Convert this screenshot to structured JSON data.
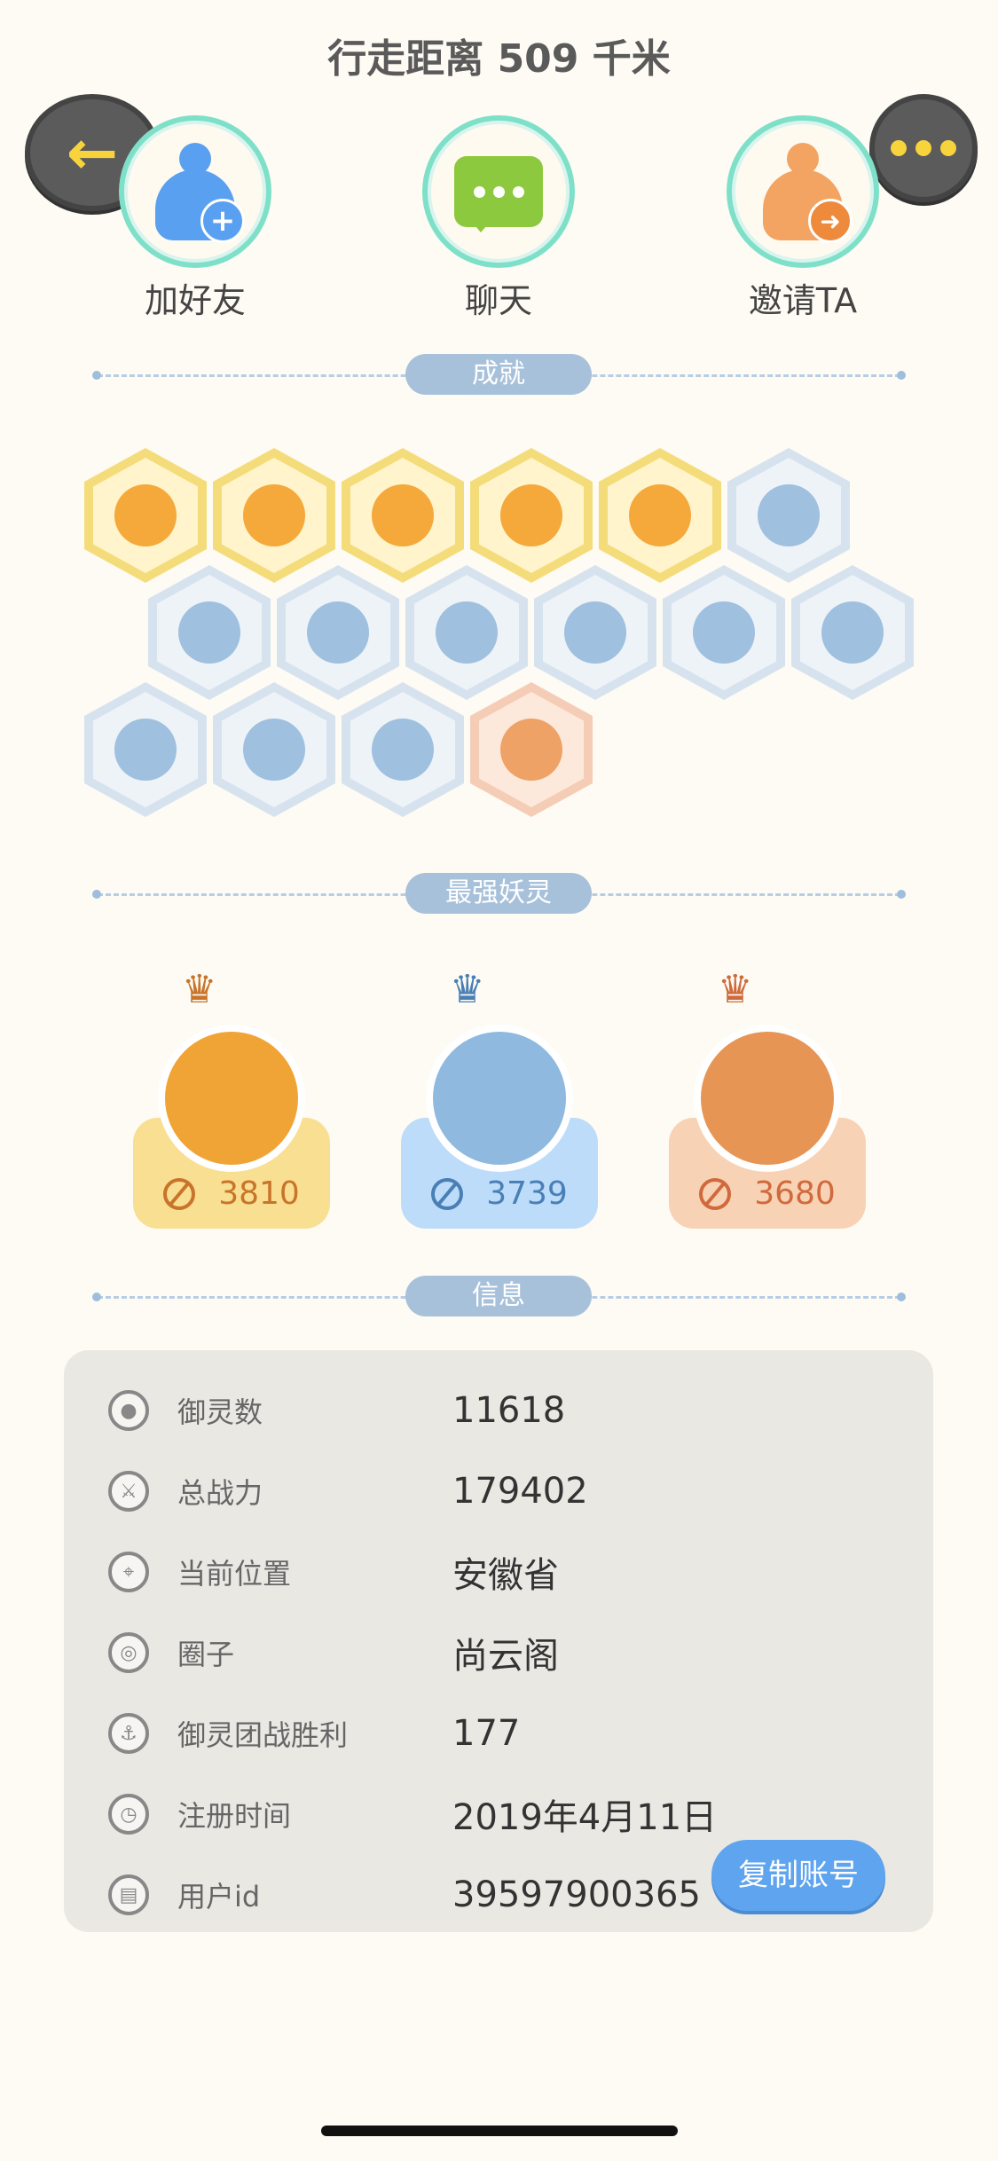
{
  "header": {
    "title": "行走距离 509 千米"
  },
  "actions": [
    {
      "label": "加好友",
      "icon": "add-friend-icon"
    },
    {
      "label": "聊天",
      "icon": "chat-icon"
    },
    {
      "label": "邀请TA",
      "icon": "invite-icon"
    }
  ],
  "sections": {
    "achievements": "成就",
    "strongest": "最强妖灵",
    "info": "信息"
  },
  "achievements": {
    "badges": [
      {
        "tier": "gold"
      },
      {
        "tier": "gold"
      },
      {
        "tier": "gold"
      },
      {
        "tier": "gold"
      },
      {
        "tier": "gold"
      },
      {
        "tier": "blue"
      },
      {
        "tier": "blue"
      },
      {
        "tier": "blue"
      },
      {
        "tier": "blue"
      },
      {
        "tier": "blue"
      },
      {
        "tier": "blue"
      },
      {
        "tier": "blue"
      },
      {
        "tier": "blue"
      },
      {
        "tier": "blue"
      },
      {
        "tier": "blue"
      },
      {
        "tier": "peach"
      }
    ]
  },
  "strongest": [
    {
      "power": "3810",
      "color": "#f9df92",
      "text_color": "#c8742a",
      "avatar_color": "#f0a435"
    },
    {
      "power": "3739",
      "color": "#bcdcfa",
      "text_color": "#4a7fb5",
      "avatar_color": "#8fb9de"
    },
    {
      "power": "3680",
      "color": "#f8d2b4",
      "text_color": "#d06a3c",
      "avatar_color": "#e69555"
    }
  ],
  "info": {
    "rows": [
      {
        "label": "御灵数",
        "value": "11618",
        "icon": "spirit-icon"
      },
      {
        "label": "总战力",
        "value": "179402",
        "icon": "sword-icon"
      },
      {
        "label": "当前位置",
        "value": "安徽省",
        "icon": "location-icon"
      },
      {
        "label": "圈子",
        "value": "尚云阁",
        "icon": "circle-icon"
      },
      {
        "label": "御灵团战胜利",
        "value": "177",
        "icon": "anchor-icon"
      },
      {
        "label": "注册时间",
        "value": "2019年4月11日",
        "icon": "clock-icon"
      },
      {
        "label": "用户id",
        "value": "39597900365",
        "icon": "id-card-icon"
      }
    ],
    "copy_button": "复制账号"
  }
}
